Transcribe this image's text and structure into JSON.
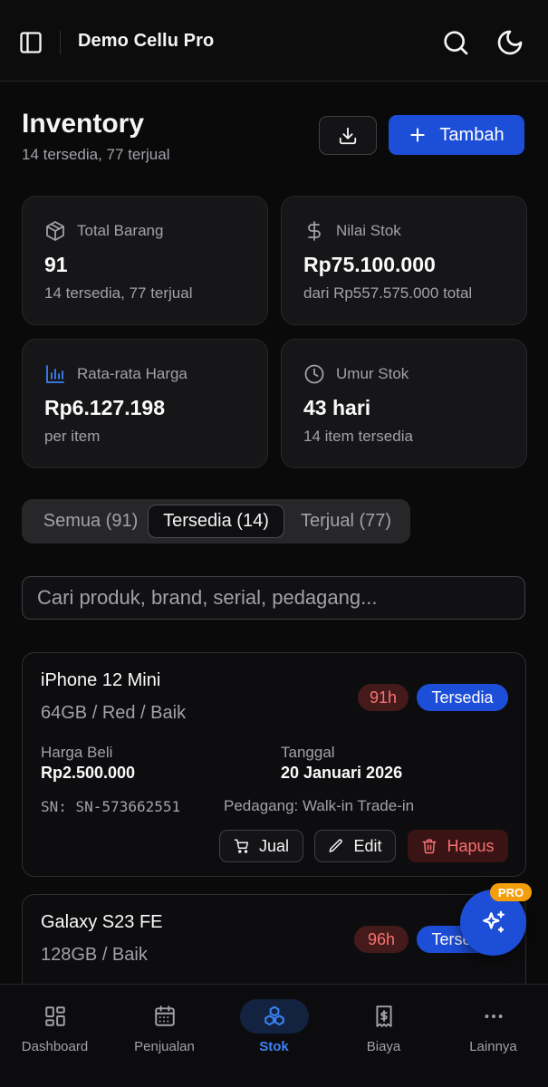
{
  "header": {
    "app_name": "Demo Cellu Pro"
  },
  "page": {
    "title": "Inventory",
    "subtitle": "14 tersedia, 77 terjual",
    "add_label": "Tambah"
  },
  "stats": [
    {
      "label": "Total Barang",
      "value": "91",
      "desc": "14 tersedia, 77 terjual",
      "icon": "box-icon"
    },
    {
      "label": "Nilai Stok",
      "value": "Rp75.100.000",
      "desc": "dari Rp557.575.000 total",
      "icon": "dollar-icon"
    },
    {
      "label": "Rata-rata Harga",
      "value": "Rp6.127.198",
      "desc": "per item",
      "icon": "bar-chart-icon"
    },
    {
      "label": "Umur Stok",
      "value": "43 hari",
      "desc": "14 item tersedia",
      "icon": "clock-icon"
    }
  ],
  "tabs": [
    {
      "label": "Semua (91)",
      "active": false
    },
    {
      "label": "Tersedia (14)",
      "active": true
    },
    {
      "label": "Terjual (77)",
      "active": false
    }
  ],
  "search": {
    "placeholder": "Cari produk, brand, serial, pedagang...",
    "value": ""
  },
  "items": [
    {
      "name": "iPhone 12 Mini",
      "variant": "64GB / Red / Baik",
      "age": "91h",
      "status": "Tersedia",
      "buy_label": "Harga Beli",
      "buy_price": "Rp2.500.000",
      "date_label": "Tanggal",
      "date": "20 Januari 2026",
      "serial": "SN: SN-573662551",
      "dealer": "Pedagang: Walk-in Trade-in",
      "actions": {
        "sell": "Jual",
        "edit": "Edit",
        "delete": "Hapus"
      }
    },
    {
      "name": "Galaxy S23 FE",
      "variant": "128GB / Baik",
      "age": "96h",
      "status": "Tersedia"
    }
  ],
  "fab": {
    "badge": "PRO",
    "icon": "sparkles-icon"
  },
  "nav": [
    {
      "label": "Dashboard",
      "icon": "dashboard-icon",
      "active": false
    },
    {
      "label": "Penjualan",
      "icon": "calendar-icon",
      "active": false
    },
    {
      "label": "Stok",
      "icon": "boxes-icon",
      "active": true
    },
    {
      "label": "Biaya",
      "icon": "receipt-icon",
      "active": false
    },
    {
      "label": "Lainnya",
      "icon": "more-icon",
      "active": false
    }
  ],
  "colors": {
    "accent": "#1d4ed8",
    "danger": "#f87171",
    "pro": "#f59e0b",
    "nav_active": "#3b82f6"
  }
}
